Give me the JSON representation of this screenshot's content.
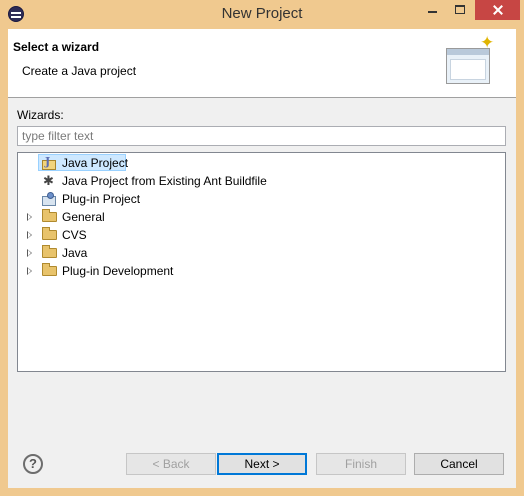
{
  "window": {
    "title": "New Project"
  },
  "header": {
    "title": "Select a wizard",
    "description": "Create a Java project"
  },
  "wizards_label": "Wizards:",
  "filter": {
    "placeholder": "type filter text",
    "value": ""
  },
  "tree": [
    {
      "label": "Java Project",
      "icon": "java-project-icon",
      "expandable": false,
      "selected": true
    },
    {
      "label": "Java Project from Existing Ant Buildfile",
      "icon": "ant-icon",
      "expandable": false,
      "selected": false
    },
    {
      "label": "Plug-in Project",
      "icon": "plugin-project-icon",
      "expandable": false,
      "selected": false
    },
    {
      "label": "General",
      "icon": "folder-icon",
      "expandable": true,
      "selected": false
    },
    {
      "label": "CVS",
      "icon": "folder-icon",
      "expandable": true,
      "selected": false
    },
    {
      "label": "Java",
      "icon": "folder-icon",
      "expandable": true,
      "selected": false
    },
    {
      "label": "Plug-in Development",
      "icon": "folder-icon",
      "expandable": true,
      "selected": false
    }
  ],
  "buttons": {
    "back": "< Back",
    "next": "Next >",
    "finish": "Finish",
    "cancel": "Cancel",
    "help": "?"
  },
  "colors": {
    "title_bar": "#f0c98f",
    "selection": "#cde8ff",
    "close": "#c74644"
  }
}
